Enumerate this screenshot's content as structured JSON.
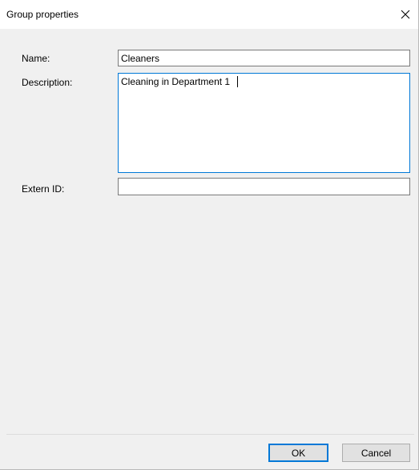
{
  "window": {
    "title": "Group properties",
    "close_icon": "close-icon"
  },
  "form": {
    "name_label": "Name:",
    "name_value": "Cleaners",
    "description_label": "Description:",
    "description_value": "Cleaning in Department 1",
    "extern_id_label": "Extern ID:",
    "extern_id_value": ""
  },
  "buttons": {
    "ok_label": "OK",
    "cancel_label": "Cancel"
  },
  "colors": {
    "focus_border": "#0078d7",
    "background": "#f0f0f0"
  }
}
